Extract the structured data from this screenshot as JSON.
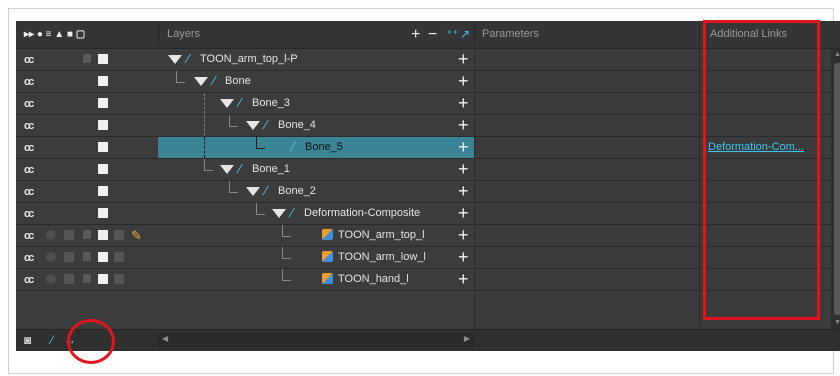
{
  "header": {
    "layers_label": "Layers",
    "parameters_label": "Parameters",
    "additional_links_label": "Additional Links",
    "add_label": "+",
    "remove_label": "−"
  },
  "rows": [
    {
      "name": "TOON_arm_top_l-P",
      "type": "bone",
      "selected": false,
      "link": ""
    },
    {
      "name": "Bone",
      "type": "bone",
      "selected": false,
      "link": ""
    },
    {
      "name": "Bone_3",
      "type": "bone",
      "selected": false,
      "link": ""
    },
    {
      "name": "Bone_4",
      "type": "bone",
      "selected": false,
      "link": ""
    },
    {
      "name": "Bone_5",
      "type": "bone",
      "selected": true,
      "link": "Deformation-Com..."
    },
    {
      "name": "Bone_1",
      "type": "bone",
      "selected": false,
      "link": ""
    },
    {
      "name": "Bone_2",
      "type": "bone",
      "selected": false,
      "link": ""
    },
    {
      "name": "Deformation-Composite",
      "type": "bone",
      "selected": false,
      "link": ""
    },
    {
      "name": "TOON_arm_top_l",
      "type": "drawing",
      "selected": false,
      "link": ""
    },
    {
      "name": "TOON_arm_low_l",
      "type": "drawing",
      "selected": false,
      "link": ""
    },
    {
      "name": "TOON_hand_l",
      "type": "drawing",
      "selected": false,
      "link": ""
    }
  ],
  "icons": {
    "show_all": "eye-toggle-icon",
    "bone": "bone-icon",
    "drawing": "drawing-layer-icon",
    "add_layer": "add-layer-icon",
    "camera": "camera-icon",
    "show_links": "show-links-arrow-icon"
  },
  "colors": {
    "selection": "#3a8496",
    "link": "#3ec6f0",
    "highlight": "#e0141c"
  }
}
